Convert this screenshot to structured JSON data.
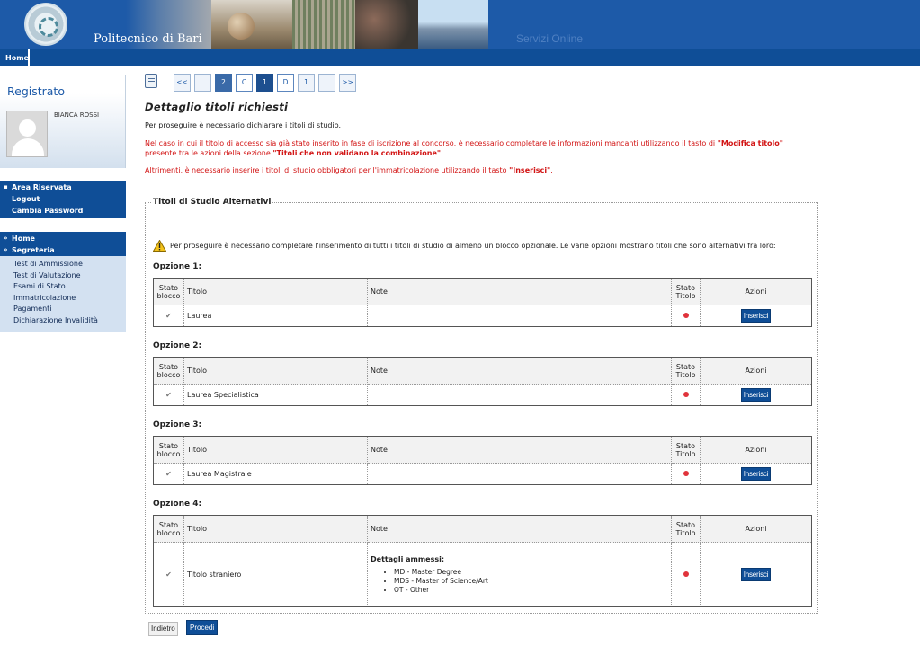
{
  "header": {
    "brand": "Politecnico di Bari",
    "services": "Servizi Online"
  },
  "nav": {
    "home": "Home"
  },
  "sidebar": {
    "title": "Registrato",
    "username": "BIANCA ROSSI",
    "menu_area": [
      {
        "label": "Area Riservata",
        "head": true
      },
      {
        "label": "Logout"
      },
      {
        "label": "Cambia Password"
      }
    ],
    "menu_main": [
      {
        "label": "Home"
      },
      {
        "label": "Segreteria"
      }
    ],
    "submenu": [
      "Test di Ammissione",
      "Test di Valutazione",
      "Esami di Stato",
      "Immatricolazione",
      "Pagamenti",
      "Dichiarazione Invalidità"
    ]
  },
  "pager": [
    "<<",
    "...",
    "2",
    "C",
    "1",
    "D",
    "1",
    "...",
    ">>"
  ],
  "main": {
    "title": "Dettaglio titoli richiesti",
    "intro": "Per proseguire è necessario dichiarare i titoli di studio.",
    "warn1_a": "Nel caso in cui il titolo di accesso sia già stato inserito in fase di iscrizione al concorso, è necessario completare le informazioni mancanti utilizzando il tasto di ",
    "warn1_b": "\"Modifica titolo\"",
    "warn1_c": " presente tra le azioni della sezione ",
    "warn1_d": "\"Titoli che non validano la combinazione\"",
    "warn1_e": ".",
    "warn2_a": "Altrimenti, è necessario inserire i titoli di studio obbligatori per l'immatricolazione utilizzando il tasto ",
    "warn2_b": "\"Inserisci\"",
    "warn2_c": ".",
    "fieldset_legend": "Titoli di Studio Alternativi",
    "notice": "Per proseguire è necessario completare l'inserimento di tutti i titoli di studio di almeno un blocco opzionale. Le varie opzioni mostrano titoli che sono alternativi fra loro:"
  },
  "table_headers": {
    "stato_blocco_1": "Stato",
    "stato_blocco_2": "blocco",
    "titolo": "Titolo",
    "note": "Note",
    "stato_titolo_1": "Stato",
    "stato_titolo_2": "Titolo",
    "azioni": "Azioni"
  },
  "options": [
    {
      "label": "Opzione 1:",
      "titolo": "Laurea",
      "insert": "Inserisci"
    },
    {
      "label": "Opzione 2:",
      "titolo": "Laurea Specialistica",
      "insert": "Inserisci"
    },
    {
      "label": "Opzione 3:",
      "titolo": "Laurea Magistrale",
      "insert": "Inserisci"
    },
    {
      "label": "Opzione 4:",
      "titolo": "Titolo straniero",
      "insert": "Inserisci",
      "details_title": "Dettagli ammessi:",
      "details": [
        "MD - Master Degree",
        "MDS - Master of Science/Art",
        "OT - Other"
      ]
    }
  ],
  "buttons": {
    "back": "Indietro",
    "next": "Procedi"
  },
  "colors": {
    "primary": "#0f4e97",
    "warning": "#d21414",
    "status_dot": "#e0333b"
  }
}
